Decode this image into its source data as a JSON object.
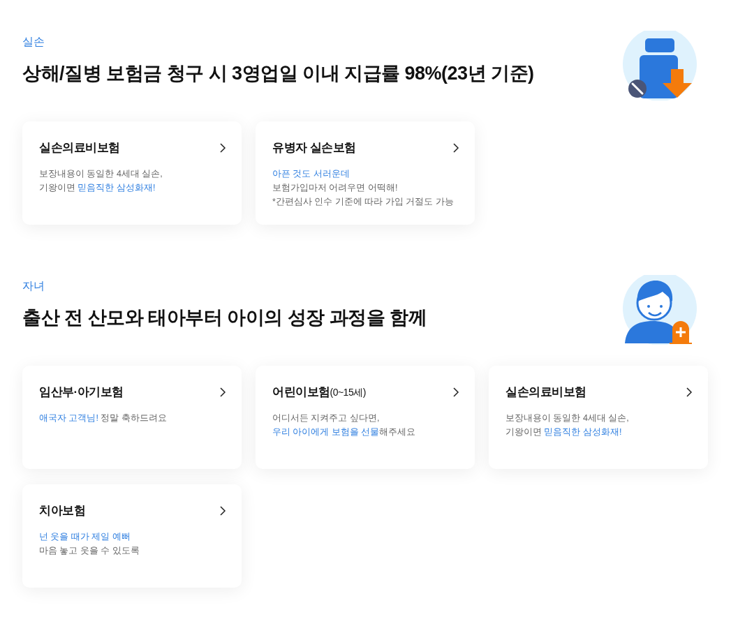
{
  "sections": [
    {
      "category": "실손",
      "heading": "상해/질병 보험금 청구 시 3영업일 이내 지급률 98%(23년 기준)",
      "illustration": {
        "kind": "medicine"
      },
      "cards": [
        {
          "title": "실손의료비보험",
          "lines": [
            [
              {
                "text": "보장내용이 동일한 4세대 실손,",
                "accent": false
              }
            ],
            [
              {
                "text": "기왕이면 ",
                "accent": false
              },
              {
                "text": "믿음직한 삼성화재!",
                "accent": true
              }
            ]
          ]
        },
        {
          "title": "유병자 실손보험",
          "lines": [
            [
              {
                "text": "아픈 것도 서러운데",
                "accent": true
              }
            ],
            [
              {
                "text": "보험가입마저 어려우면 어떡해!",
                "accent": false
              }
            ],
            [
              {
                "text": "*간편심사 인수 기준에 따라 가입 거절도 가능",
                "accent": false
              }
            ]
          ]
        }
      ]
    },
    {
      "category": "자녀",
      "heading": "출산 전 산모와 태아부터 아이의 성장 과정을 함께",
      "illustration": {
        "kind": "child"
      },
      "cards": [
        {
          "title": "임산부·아기보험",
          "lines": [
            [
              {
                "text": "애국자 고객님!",
                "accent": true
              },
              {
                "text": " 정말 축하드려요",
                "accent": false
              }
            ]
          ]
        },
        {
          "title": "어린이보험",
          "title_note": "(0~15세)",
          "lines": [
            [
              {
                "text": "어디서든 지켜주고 싶다면,",
                "accent": false
              }
            ],
            [
              {
                "text": "우리 아이에게 보험을 선물",
                "accent": true
              },
              {
                "text": "해주세요",
                "accent": false
              }
            ]
          ]
        },
        {
          "title": "실손의료비보험",
          "lines": [
            [
              {
                "text": "보장내용이 동일한 4세대 실손,",
                "accent": false
              }
            ],
            [
              {
                "text": "기왕이면 ",
                "accent": false
              },
              {
                "text": "믿음직한 삼성화재!",
                "accent": true
              }
            ]
          ]
        },
        {
          "title": "치아보험",
          "lines": [
            [
              {
                "text": "넌 웃을 때가 제일 예뻐",
                "accent": true
              }
            ],
            [
              {
                "text": "마음 놓고 웃을 수 있도록",
                "accent": false
              }
            ]
          ]
        }
      ]
    }
  ]
}
